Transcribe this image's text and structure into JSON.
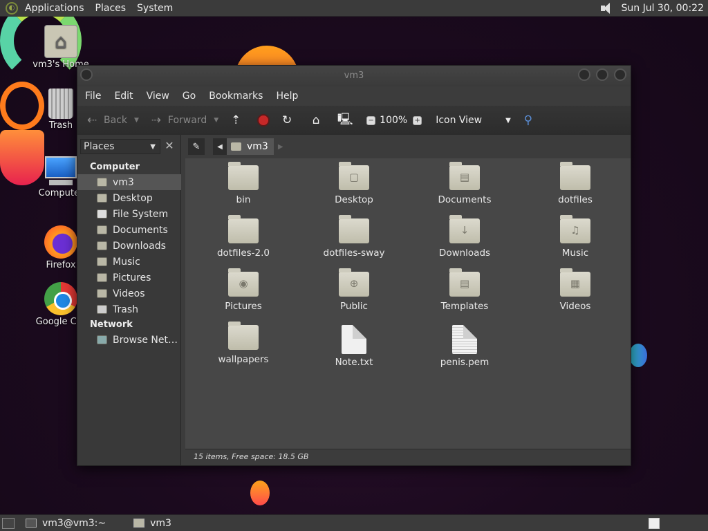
{
  "top_panel": {
    "menus": [
      "Applications",
      "Places",
      "System"
    ],
    "clock": "Sun Jul 30, 00:22",
    "icons": {
      "logo": "distro-logo-icon",
      "volume": "volume-icon"
    }
  },
  "desktop_icons": [
    {
      "label": "vm3's Home",
      "icon": "home-folder-icon"
    },
    {
      "label": "Trash",
      "icon": "trash-icon"
    },
    {
      "label": "Computer",
      "icon": "computer-icon"
    },
    {
      "label": "Firefox",
      "icon": "firefox-icon"
    },
    {
      "label": "Google Chr",
      "icon": "chrome-icon"
    }
  ],
  "window": {
    "title": "vm3",
    "menubar": [
      "File",
      "Edit",
      "View",
      "Go",
      "Bookmarks",
      "Help"
    ],
    "toolbar": {
      "back": "Back",
      "forward": "Forward",
      "zoom": "100%",
      "view_mode": "Icon View"
    },
    "sidebar": {
      "selector": "Places",
      "sections": [
        {
          "title": "Computer",
          "items": [
            "vm3",
            "Desktop",
            "File System",
            "Documents",
            "Downloads",
            "Music",
            "Pictures",
            "Videos",
            "Trash"
          ]
        },
        {
          "title": "Network",
          "items": [
            "Browse Net…"
          ]
        }
      ],
      "selected": "vm3"
    },
    "path": {
      "current": "vm3"
    },
    "files": [
      {
        "name": "bin",
        "type": "folder",
        "glyph": ""
      },
      {
        "name": "Desktop",
        "type": "folder",
        "glyph": "▢"
      },
      {
        "name": "Documents",
        "type": "folder",
        "glyph": "▤"
      },
      {
        "name": "dotfiles",
        "type": "folder",
        "glyph": ""
      },
      {
        "name": "dotfiles-2.0",
        "type": "folder",
        "glyph": ""
      },
      {
        "name": "dotfiles-sway",
        "type": "folder",
        "glyph": ""
      },
      {
        "name": "Downloads",
        "type": "folder",
        "glyph": "↓"
      },
      {
        "name": "Music",
        "type": "folder",
        "glyph": "♫"
      },
      {
        "name": "Pictures",
        "type": "folder",
        "glyph": "◉"
      },
      {
        "name": "Public",
        "type": "folder",
        "glyph": "⊕"
      },
      {
        "name": "Templates",
        "type": "folder",
        "glyph": "▤"
      },
      {
        "name": "Videos",
        "type": "folder",
        "glyph": "▦"
      },
      {
        "name": "wallpapers",
        "type": "folder",
        "glyph": ""
      },
      {
        "name": "Note.txt",
        "type": "text",
        "glyph": ""
      },
      {
        "name": "penis.pem",
        "type": "certificate",
        "glyph": ""
      }
    ],
    "status": "15 items, Free space: 18.5 GB"
  },
  "bottom_panel": {
    "tasks": [
      {
        "label": "vm3@vm3:~",
        "icon": "terminal-icon"
      },
      {
        "label": "vm3",
        "icon": "folder-icon"
      }
    ]
  }
}
